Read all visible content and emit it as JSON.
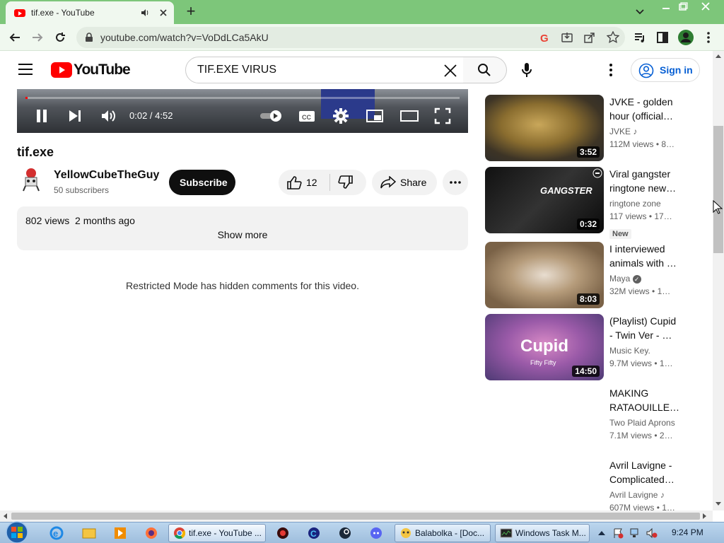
{
  "browser": {
    "tab_title": "tif.exe - YouTube",
    "url": "youtube.com/watch?v=VoDdLCa5AkU"
  },
  "youtube": {
    "logo_text": "YouTube",
    "search_query": "TIF.EXE VIRUS",
    "signin_label": "Sign in"
  },
  "player": {
    "time": "0:02 / 4:52",
    "progress_fraction": 0.004
  },
  "video": {
    "title": "tif.exe",
    "channel": "YellowCubeTheGuy",
    "subscribers": "50 subscribers",
    "subscribe_label": "Subscribe",
    "likes": "12",
    "share_label": "Share",
    "views": "802 views",
    "age": "2 months ago",
    "show_more": "Show more",
    "comments_notice": "Restricted Mode has hidden comments for this video."
  },
  "recommendations": [
    {
      "title": "JVKE - golden hour (official…",
      "channel": "JVKE",
      "views": "112M views",
      "age": "• 8…",
      "duration": "3:52",
      "music": true
    },
    {
      "title": "Viral gangster ringtone new…",
      "channel": "ringtone zone",
      "views": "117 views",
      "age": "• 17…",
      "duration": "0:32",
      "badge": "New"
    },
    {
      "title": "I interviewed animals with …",
      "channel": "Maya",
      "views": "32M views",
      "age": "• 1…",
      "duration": "8:03",
      "verified": true
    },
    {
      "title": "(Playlist) Cupid - Twin Ver - …",
      "channel": "Music Key.",
      "views": "9.7M views",
      "age": "• 1…",
      "duration": "14:50"
    },
    {
      "title": "MAKING RATAOUILLE…",
      "channel": "Two Plaid Aprons",
      "views": "7.1M views",
      "age": "• 2…",
      "duration": ""
    },
    {
      "title": "Avril Lavigne - Complicated…",
      "channel": "Avril Lavigne",
      "views": "607M views",
      "age": "• 1…",
      "duration": "",
      "music": true
    }
  ],
  "thumb_text": {
    "gangster": "GANGSTER",
    "cupid": "Cupid",
    "cupid_sub": "Fifty Fifty"
  },
  "taskbar": {
    "chrome_task": "tif.exe - YouTube ...",
    "balabolka_task": "Balabolka - [Doc...",
    "taskmgr_task": "Windows Task M...",
    "clock": "9:24 PM"
  }
}
